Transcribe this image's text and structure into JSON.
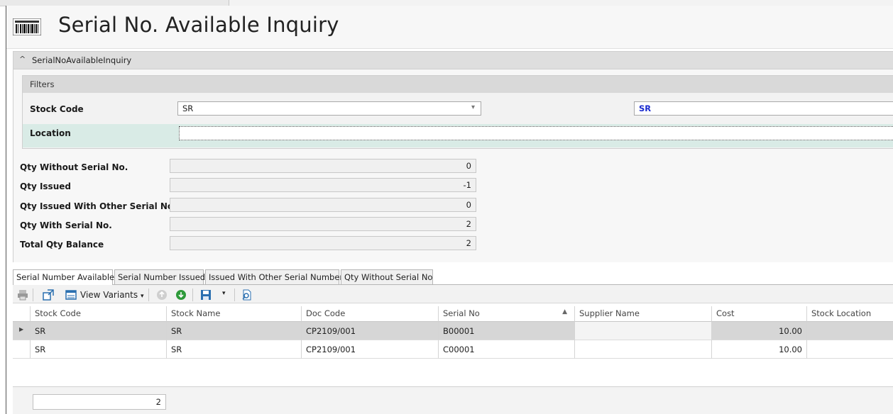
{
  "page": {
    "title": "Serial No. Available Inquiry"
  },
  "group": {
    "label": "SerialNoAvailableInquiry"
  },
  "filters": {
    "heading": "Filters",
    "stock_code_label": "Stock Code",
    "stock_code_value": "SR",
    "stock_code_name": "SR",
    "location_label": "Location",
    "location_value": ""
  },
  "qty": [
    {
      "label": "Qty Without Serial No.",
      "value": "0"
    },
    {
      "label": "Qty Issued",
      "value": "-1"
    },
    {
      "label": "Qty Issued With Other Serial No.",
      "value": "0"
    },
    {
      "label": "Qty With Serial No.",
      "value": "2"
    },
    {
      "label": "Total Qty Balance",
      "value": "2"
    }
  ],
  "tabs": [
    {
      "label": "Serial Number Available",
      "active": true
    },
    {
      "label": "Serial Number Issued",
      "active": false
    },
    {
      "label": "Issued With Other Serial Number",
      "active": false
    },
    {
      "label": "Qty Without Serial No",
      "active": false
    }
  ],
  "toolbar": {
    "view_variants_label": "View Variants"
  },
  "grid": {
    "columns": [
      "Stock Code",
      "Stock Name",
      "Doc Code",
      "Serial No",
      "Supplier Name",
      "Cost",
      "Stock Location"
    ],
    "rows": [
      [
        "SR",
        "SR",
        "CP2109/001",
        "B00001",
        "",
        "10.00",
        ""
      ],
      [
        "SR",
        "SR",
        "CP2109/001",
        "C00001",
        "",
        "10.00",
        ""
      ]
    ]
  },
  "footer": {
    "count": "2"
  },
  "colors": {
    "accent_text": "#1a2bd0",
    "location_row_bg": "#d9ebe6"
  }
}
